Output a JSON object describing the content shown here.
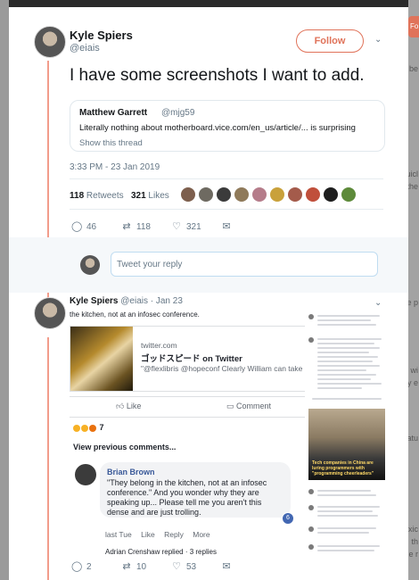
{
  "background": {
    "right_chip": "Fo",
    "right_fragments": [
      "be",
      "uicl",
      "the",
      "e p",
      "wi",
      "y e",
      "atu",
      "xic",
      "th",
      "e r"
    ]
  },
  "tweet": {
    "author_name": "Kyle Spiers",
    "author_handle": "@eiais",
    "follow_label": "Follow",
    "text": "I have some screenshots I want to add.",
    "quote": {
      "name": "Matthew Garrett",
      "handle": "@mjg59",
      "text": "Literally nothing about motherboard.vice.com/en_us/article/... is surprising",
      "show_thread": "Show this thread"
    },
    "timestamp": "3:33 PM - 23 Jan 2019",
    "retweets_count": "118",
    "retweets_label": "Retweets",
    "likes_count": "321",
    "likes_label": "Likes",
    "actions": {
      "replies": "46",
      "retweets": "118",
      "likes": "321"
    }
  },
  "reply_box": {
    "placeholder": "Tweet your reply"
  },
  "reply": {
    "author_name": "Kyle Spiers",
    "author_handle": "@eiais",
    "date": "· Jan 23",
    "actions": {
      "replies": "2",
      "retweets": "10",
      "likes": "53"
    },
    "screenshot": {
      "top_line": "the kitchen, not at an infosec conference.",
      "link_domain": "twitter.com",
      "link_title": "ゴッドスピード on Twitter",
      "link_desc": "\"@flexlibris @hopeconf Clearly William can take a ...",
      "like_label": "Like",
      "comment_label": "Comment",
      "reaction_count": "7",
      "view_previous": "View previous comments...",
      "commenter": "Brian Brown",
      "comment_text": "\"They belong in the kitchen, not at an infosec conference.\" And you wonder why they are speaking up... Please tell me you aren't this dense and are just trolling.",
      "comment_badge": "6",
      "comment_actions": [
        "last Tue",
        "Like",
        "Reply",
        "More"
      ],
      "next_line": "Adrian Crenshaw replied · 3 replies",
      "side_caption": "Tech companies in China are luring programmers with \"programming cheerleaders\""
    }
  },
  "colors": {
    "accent": "#e0735a",
    "thread_line": "#f29c8b",
    "text": "#14171a",
    "muted": "#657786"
  }
}
